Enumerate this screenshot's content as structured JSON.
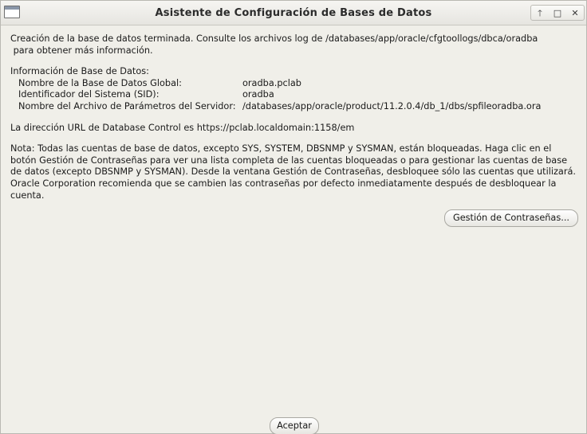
{
  "window": {
    "title": "Asistente de Configuración de Bases de Datos",
    "controls": {
      "minimize": "🡑",
      "maximize": "□",
      "close": "✕"
    }
  },
  "content": {
    "completion_line1": "Creación de la base de datos terminada. Consulte los archivos log de /databases/app/oracle/cfgtoollogs/dbca/oradba",
    "completion_line2": " para obtener más información.",
    "db_info_heading": "Información de Base de Datos:",
    "db_info": [
      {
        "label": "Nombre de la Base de Datos Global:",
        "value": "oradba.pclab"
      },
      {
        "label": "Identificador del Sistema (SID):",
        "value": "oradba"
      },
      {
        "label": "Nombre del Archivo de Parámetros del Servidor:",
        "value": "/databases/app/oracle/product/11.2.0.4/db_1/dbs/spfileoradba.ora"
      }
    ],
    "url_line": "La dirección URL de Database Control es https://pclab.localdomain:1158/em",
    "note": "Nota: Todas las cuentas de base de datos, excepto SYS, SYSTEM, DBSNMP y SYSMAN, están bloqueadas. Haga clic en el botón Gestión de Contraseñas para ver una lista completa de las cuentas bloqueadas o para gestionar las cuentas de base de datos (excepto DBSNMP y SYSMAN). Desde la ventana Gestión de Contraseñas, desbloquee sólo las cuentas que utilizará. Oracle Corporation recomienda que se cambien las contraseñas por defecto inmediatamente después de desbloquear la cuenta."
  },
  "buttons": {
    "password_management": "Gestión de Contraseñas...",
    "accept": "Aceptar"
  }
}
